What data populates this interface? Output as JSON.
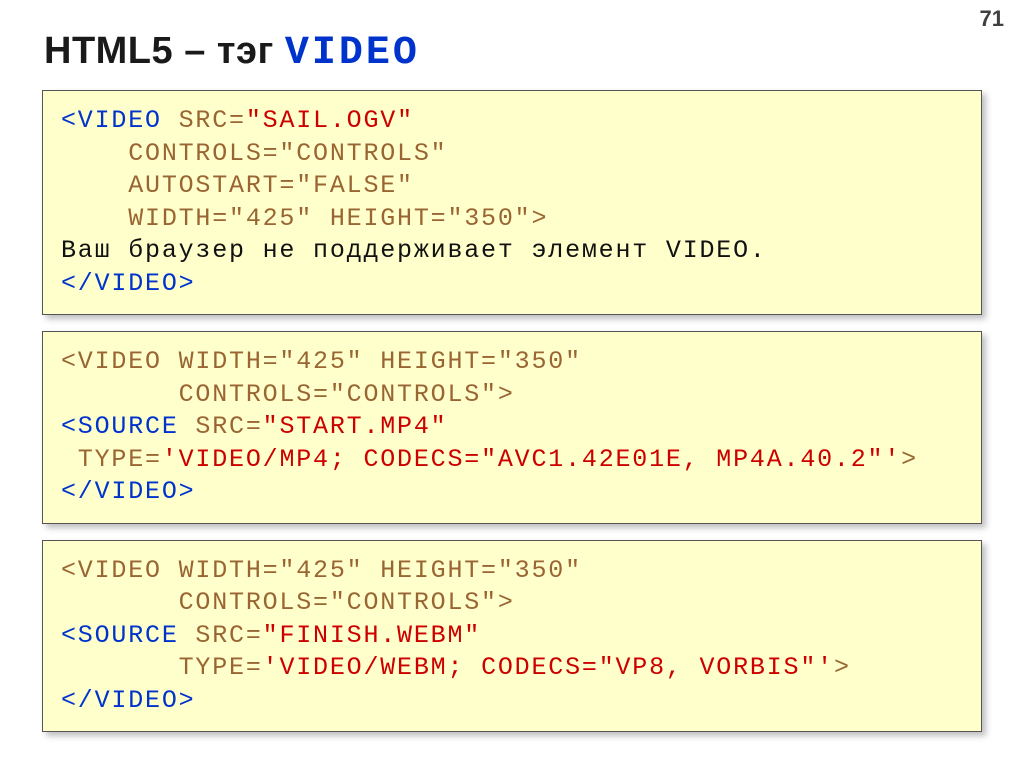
{
  "page_number": "71",
  "title_plain": "HTML5 – тэг ",
  "title_mono": "VIDEO",
  "box1": {
    "l1a": "<VIDEO",
    "l1b": " SRC=",
    "l1c": "\"SAIL.OGV\"",
    "l2": "    CONTROLS=\"CONTROLS\"",
    "l3": "    AUTOSTART=\"FALSE\"",
    "l4": "    WIDTH=\"425\" HEIGHT=\"350\">",
    "l5": "Ваш браузер не поддерживает элемент VIDEO.",
    "l6": "</VIDEO>"
  },
  "box2": {
    "l1": "<VIDEO WIDTH=\"425\" HEIGHT=\"350\"",
    "l2": "       CONTROLS=\"CONTROLS\">",
    "l3a": "<SOURCE",
    "l3b": " SRC=",
    "l3c": "\"START.MP4\"",
    "l4a": " TYPE=",
    "l4b": "'VIDEO/MP4; CODECS=\"AVC1.42E01E, MP4A.40.2\"'",
    "l4c": ">",
    "l5": "</VIDEO>"
  },
  "box3": {
    "l1": "<VIDEO WIDTH=\"425\" HEIGHT=\"350\"",
    "l2": "       CONTROLS=\"CONTROLS\">",
    "l3a": "<SOURCE",
    "l3b": " SRC=",
    "l3c": "\"FINISH.WEBM\"",
    "l4a": "       TYPE=",
    "l4b": "'VIDEO/WEBM; CODECS=\"VP8, VORBIS\"'",
    "l4c": ">",
    "l5": "</VIDEO>"
  }
}
